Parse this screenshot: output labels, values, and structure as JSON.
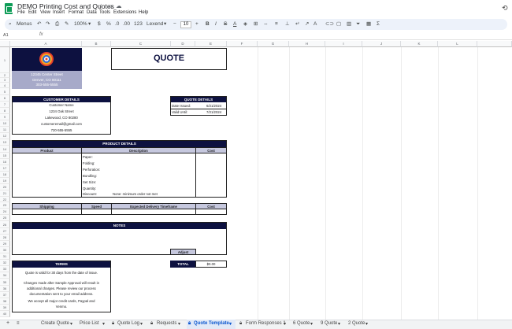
{
  "window": {
    "doc_title": "DEMO Printing Cost and Quotes",
    "menu": [
      "File",
      "Edit",
      "View",
      "Insert",
      "Format",
      "Data",
      "Tools",
      "Extensions",
      "Help"
    ]
  },
  "toolbar": {
    "search_label": "Menus",
    "zoom": "100%",
    "currency": "$",
    "percent": "%",
    "dec_less": ".0",
    "dec_more": ".00",
    "number_format": "123",
    "font_name": "Lexend",
    "font_size": "10",
    "minus": "−",
    "plus": "+"
  },
  "formula_bar": {
    "cell_ref": "A1",
    "fx": "fx",
    "value": ""
  },
  "columns": [
    "A",
    "B",
    "C",
    "D",
    "E",
    "F",
    "G",
    "H",
    "I",
    "J",
    "K",
    "L"
  ],
  "rows": [
    "1",
    "2",
    "3",
    "4",
    "5",
    "6",
    "7",
    "8",
    "9",
    "10",
    "11",
    "12",
    "13",
    "14",
    "15",
    "16",
    "17",
    "18",
    "19",
    "20",
    "21",
    "22",
    "23",
    "24",
    "25",
    "26",
    "27",
    "28",
    "29",
    "30",
    "31",
    "32",
    "33",
    "34",
    "35",
    "36",
    "37",
    "38",
    "39",
    "40",
    "41",
    "42"
  ],
  "sheet": {
    "quote_title": "QUOTE",
    "company_address": [
      "12345 Center Street",
      "Denver, CO 80111",
      "303-555-5555"
    ],
    "customer_details": {
      "header": "CUSTOMER DETAILS",
      "lines": [
        "Customer Name",
        "1234 Oak Street",
        "Lakewood, CO 80280",
        "customeremail@gmail.com",
        "720-555-5555"
      ]
    },
    "quote_details": {
      "header": "QUOTE DETAILS",
      "date_label": "Date Issued:",
      "date_value": "6/21/2024",
      "valid_label": "Valid Until:",
      "valid_value": "7/21/2024"
    },
    "product_details": {
      "header": "PRODUCT DETAILS",
      "columns": [
        "Product",
        "Description",
        "Cost"
      ],
      "lines": [
        "Paper:",
        "Folding:",
        "Perforation:",
        "Bundling:",
        "Set Size:",
        "Quantity:",
        "Discount:"
      ],
      "discount_value": "None: minimum order not met"
    },
    "shipping": {
      "columns": [
        "Shipping",
        "Speed",
        "Expected Delivery Timeframe",
        "Cost"
      ]
    },
    "notes": {
      "header": "NOTES",
      "adjust_label": "Adjust"
    },
    "total": {
      "label": "TOTAL",
      "value": "$0.00"
    },
    "terms": {
      "header": "TERMS",
      "lines": [
        "Quote is valid for 30 days from the date of issue.",
        "",
        "Changes made after Sample Approval will result in",
        "additional charges. Please review our process",
        "documentation sent to your email address.",
        "",
        "We accept all major credit cards, Paypal and",
        "Venmo."
      ]
    }
  },
  "tabs": {
    "add": "+",
    "all": "≡",
    "items": [
      "Create Quote",
      "Price List",
      "Quote Log",
      "Requests",
      "Quote Template",
      "Form Responses 1",
      "6 Quote",
      "9 Quote",
      "2 Quote"
    ],
    "active": "Quote Template"
  },
  "colors": {
    "navy": "#0d1140",
    "lavender": "#a7aac9",
    "table_header": "#c6c8de",
    "active_tab": "#0b57d0"
  },
  "icons": [
    "sheets-logo-icon",
    "star-icon",
    "folder-icon",
    "cloud-icon",
    "history-icon",
    "search-icon",
    "undo-icon",
    "redo-icon",
    "print-icon",
    "paint-format-icon"
  ]
}
